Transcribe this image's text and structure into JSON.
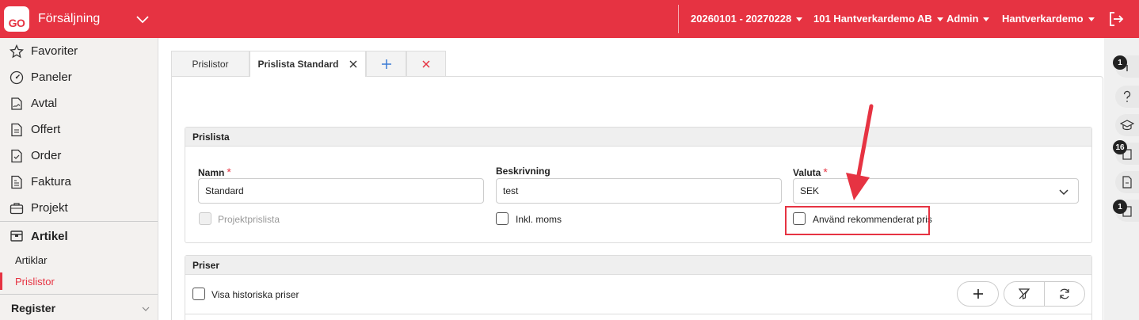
{
  "app": {
    "logo": "GO",
    "title": "Försäljning"
  },
  "topbar": {
    "period": "20260101 - 20270228",
    "company": "101 Hantverkardemo AB",
    "user": "Admin",
    "workspace": "Hantverkardemo"
  },
  "sidebar": {
    "items": [
      {
        "label": "Favoriter",
        "icon": "star-icon"
      },
      {
        "label": "Paneler",
        "icon": "gauge-icon"
      },
      {
        "label": "Avtal",
        "icon": "contract-icon"
      },
      {
        "label": "Offert",
        "icon": "document-icon"
      },
      {
        "label": "Order",
        "icon": "order-icon"
      },
      {
        "label": "Faktura",
        "icon": "invoice-icon"
      },
      {
        "label": "Projekt",
        "icon": "briefcase-icon"
      }
    ],
    "section": "Artikel",
    "subitems": [
      {
        "label": "Artiklar"
      },
      {
        "label": "Prislistor",
        "active": true
      }
    ],
    "register": "Register"
  },
  "tabs": [
    {
      "label": "Prislistor"
    },
    {
      "label": "Prislista Standard",
      "active": true
    }
  ],
  "prislista": {
    "title": "Prislista",
    "name_label": "Namn",
    "name_value": "Standard",
    "desc_label": "Beskrivning",
    "desc_value": "test",
    "currency_label": "Valuta",
    "currency_value": "SEK",
    "project_pricelist_label": "Projektprislista",
    "incl_vat_label": "Inkl. moms",
    "recommended_price_label": "Använd rekommenderat pris"
  },
  "priser": {
    "title": "Priser",
    "history_label": "Visa historiska priser"
  },
  "rail": {
    "badges": {
      "info": "1",
      "docs": "16",
      "notes": "1"
    }
  },
  "colors": {
    "brand": "#e63342",
    "annotation": "#e63342"
  }
}
